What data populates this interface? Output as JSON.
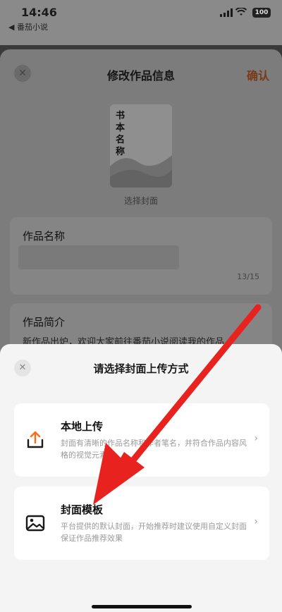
{
  "status": {
    "time": "14:46",
    "back_app": "◀ 番茄小说",
    "battery": "100"
  },
  "sheet": {
    "title": "修改作品信息",
    "confirm": "确认",
    "close_icon": "close-icon",
    "cover_title": "书本名称",
    "cover_label": "选择封面",
    "name_label": "作品名称",
    "name_count": "13/15",
    "intro_label": "作品简介",
    "intro_text": "新作品出炉，欢迎大家前往番茄小说阅读我的作品"
  },
  "action_sheet": {
    "title": "请选择封面上传方式",
    "options": [
      {
        "title": "本地上传",
        "desc": "封面有清晰的作品名称和作者笔名，并符合作品内容风格的视觉元素",
        "icon": "upload-icon"
      },
      {
        "title": "封面模板",
        "desc": "平台提供的默认封面，开始推荐时建议使用自定义封面保证作品推荐效果",
        "icon": "image-icon"
      }
    ]
  },
  "colors": {
    "accent": "#ff6a1a",
    "arrow": "#e8231f"
  }
}
